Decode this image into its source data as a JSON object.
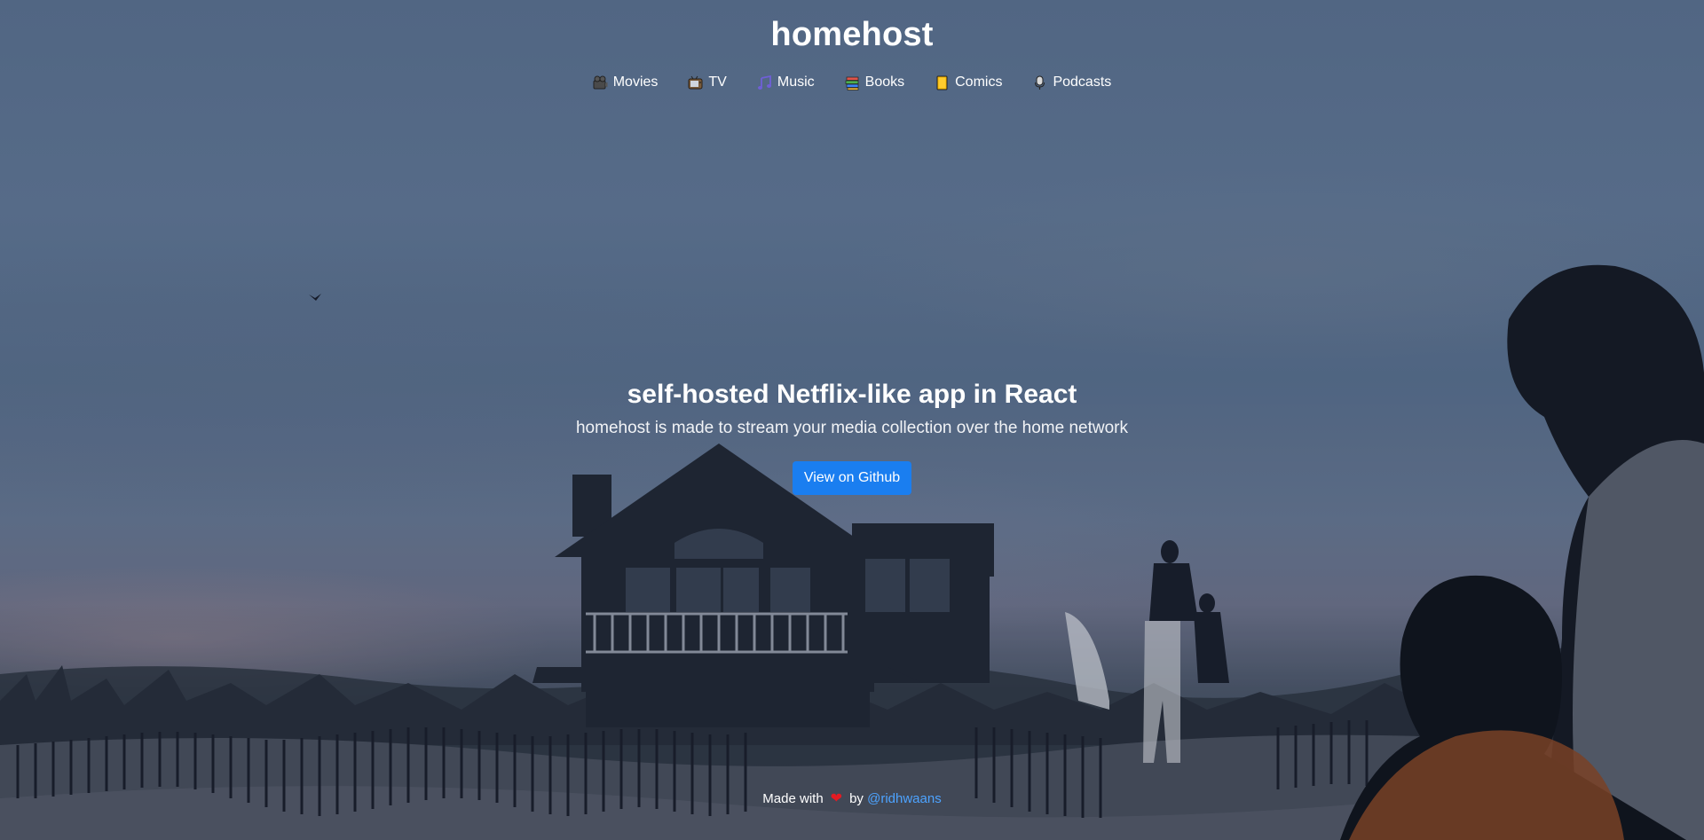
{
  "header": {
    "brand": "homehost",
    "nav": [
      {
        "label": "Movies",
        "icon": "film-projector-icon"
      },
      {
        "label": "TV",
        "icon": "television-icon"
      },
      {
        "label": "Music",
        "icon": "music-note-icon"
      },
      {
        "label": "Books",
        "icon": "books-icon"
      },
      {
        "label": "Comics",
        "icon": "comic-book-icon"
      },
      {
        "label": "Podcasts",
        "icon": "microphone-icon"
      }
    ]
  },
  "hero": {
    "title": "self-hosted Netflix-like app in React",
    "subtitle": "homehost is made to stream your media collection over the home network",
    "button_label": "View on Github"
  },
  "footer": {
    "prefix": "Made with",
    "heart": "❤",
    "by": "by",
    "author": "@ridhwaans"
  },
  "colors": {
    "accent": "#1a7ef0",
    "link": "#4da3ff",
    "heart": "#e31b23"
  }
}
